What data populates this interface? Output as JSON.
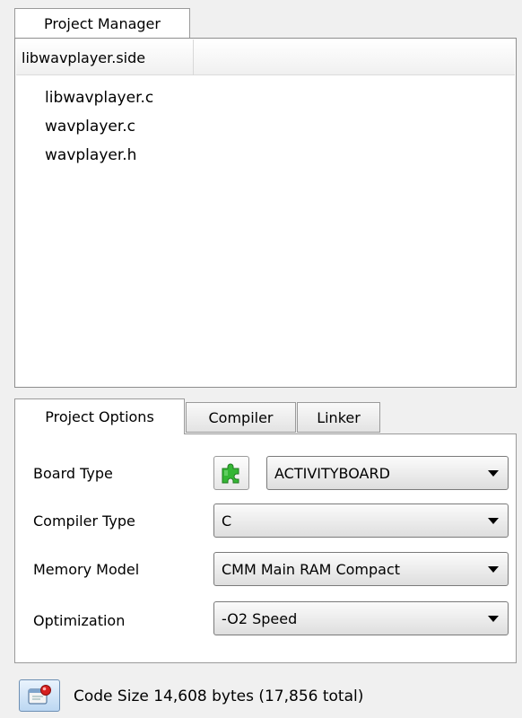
{
  "project_manager": {
    "tab_label": "Project Manager",
    "project_file": "libwavplayer.side",
    "files": [
      "libwavplayer.c",
      "wavplayer.c",
      "wavplayer.h"
    ]
  },
  "options": {
    "tabs": [
      "Project Options",
      "Compiler",
      "Linker"
    ],
    "active_tab": "Project Options",
    "board_type": {
      "label": "Board Type",
      "value": "ACTIVITYBOARD",
      "icon": "puzzle-piece-icon"
    },
    "compiler_type": {
      "label": "Compiler Type",
      "value": "C"
    },
    "memory_model": {
      "label": "Memory Model",
      "value": "CMM Main RAM Compact"
    },
    "optimization": {
      "label": "Optimization",
      "value": "-O2 Speed"
    }
  },
  "status": {
    "icon": "build-status-icon",
    "text": "Code Size 14,608 bytes (17,856 total)"
  },
  "colors": {
    "puzzle_green": "#35b635",
    "status_blue": "#bcd7f2",
    "status_red": "#d62020"
  }
}
